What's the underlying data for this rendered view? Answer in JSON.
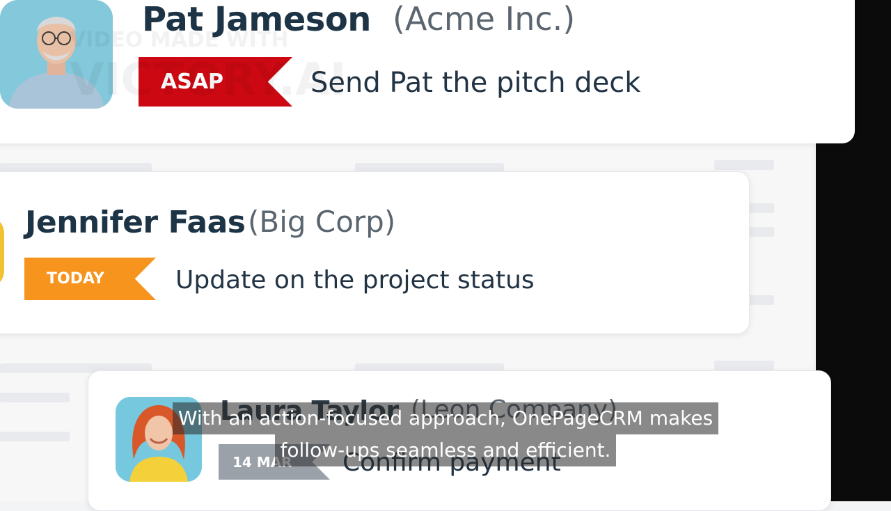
{
  "contacts": {
    "pat": {
      "name": "Pat Jameson",
      "company": "(Acme Inc.)",
      "tag": "ASAP",
      "task": "Send Pat the pitch deck",
      "tag_color": "#cc0912"
    },
    "jennifer": {
      "name": "Jennifer Faas",
      "company": "(Big Corp)",
      "tag": "TODAY",
      "task": "Update on the project status",
      "tag_color": "#f7941d"
    },
    "laura": {
      "name": "Laura Taylor",
      "company": "(Leon Company)",
      "tag": "14 MAR",
      "task": "Confirm payment",
      "tag_color": "#9aa1a8"
    }
  },
  "watermark": {
    "line1": "VIDEO MADE WITH",
    "line2": "VICTORY.AI"
  },
  "caption": {
    "line1": "With an action-focused approach, OnePageCRM makes",
    "line2": "follow-ups seamless and efficient."
  }
}
